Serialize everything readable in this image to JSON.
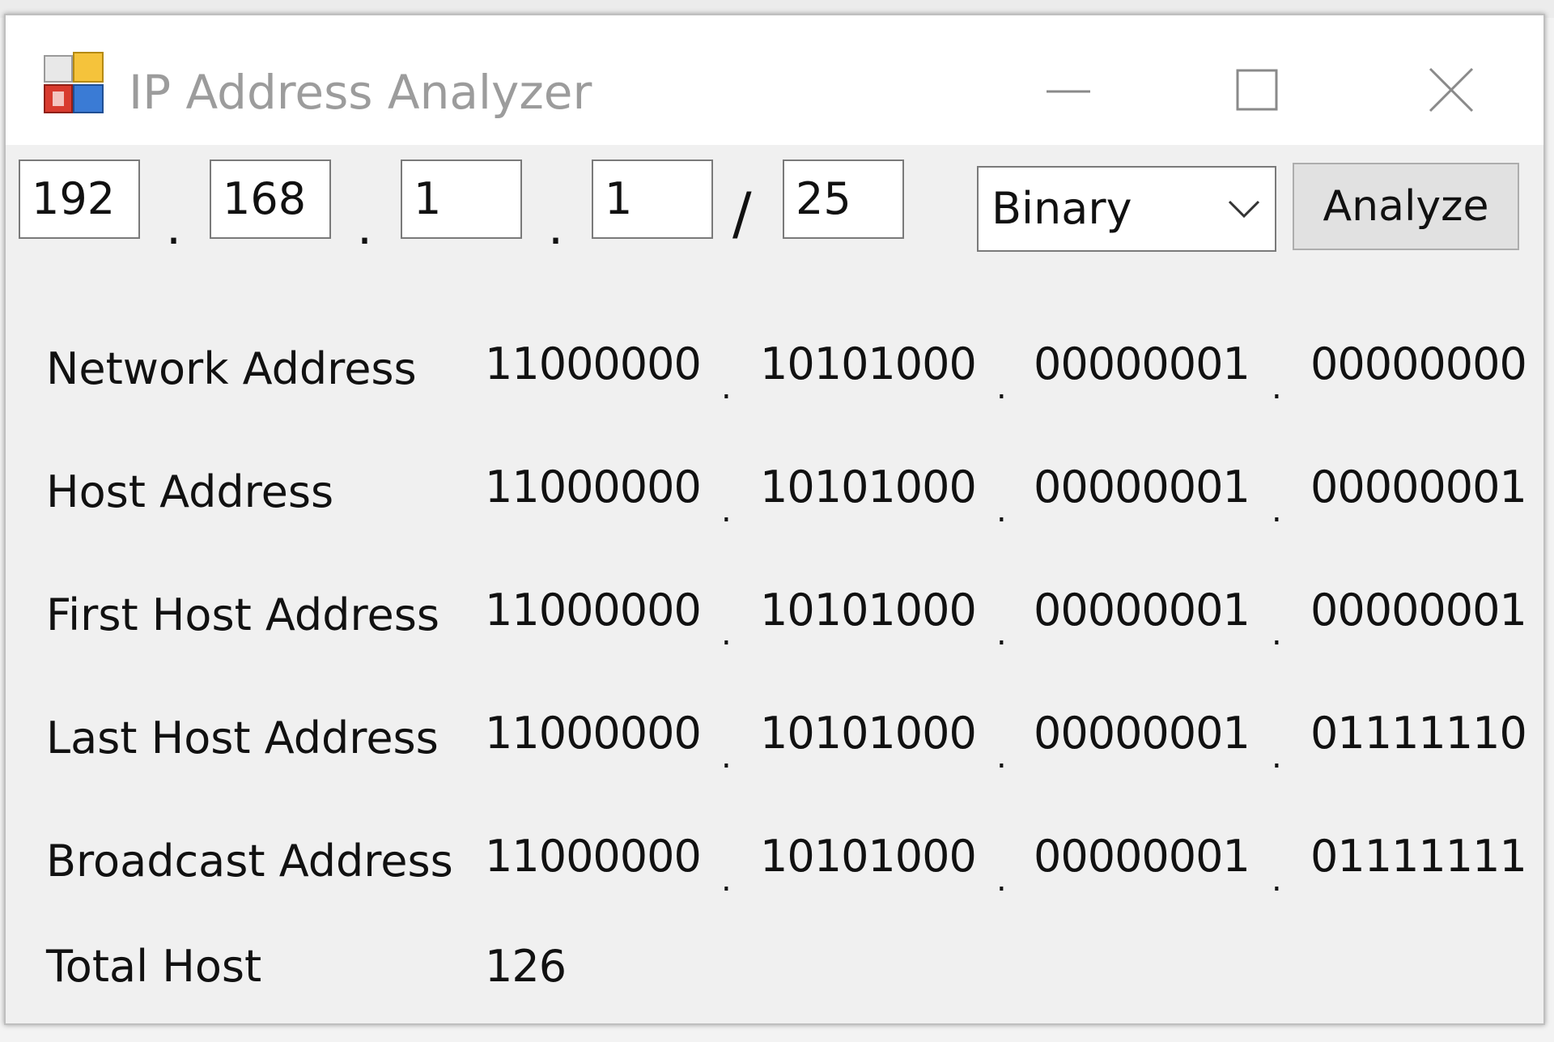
{
  "window": {
    "title": "IP Address Analyzer"
  },
  "input": {
    "octets": [
      "192",
      "168",
      "1",
      "1"
    ],
    "cidr": "25",
    "dot": ".",
    "slash": "/",
    "format": "Binary",
    "analyze_label": "Analyze"
  },
  "results": {
    "dot": ".",
    "rows": [
      {
        "label": "Network Address",
        "octets": [
          "11000000",
          "10101000",
          "00000001",
          "00000000"
        ]
      },
      {
        "label": "Host Address",
        "octets": [
          "11000000",
          "10101000",
          "00000001",
          "00000001"
        ]
      },
      {
        "label": "First Host Address",
        "octets": [
          "11000000",
          "10101000",
          "00000001",
          "00000001"
        ]
      },
      {
        "label": "Last Host Address",
        "octets": [
          "11000000",
          "10101000",
          "00000001",
          "01111110"
        ]
      },
      {
        "label": "Broadcast Address",
        "octets": [
          "11000000",
          "10101000",
          "00000001",
          "01111111"
        ]
      }
    ],
    "total_label": "Total Host",
    "total_value": "126"
  },
  "icons": {
    "app": "app-grid-icon",
    "minimize": "minimize-icon",
    "maximize": "maximize-icon",
    "close": "close-icon",
    "dropdown": "chevron-down-icon"
  }
}
